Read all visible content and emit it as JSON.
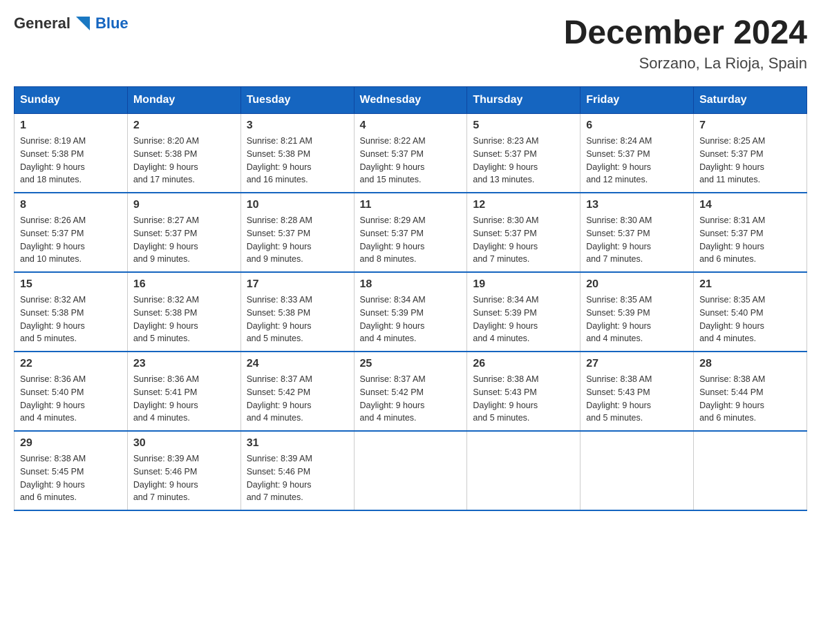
{
  "logo": {
    "general": "General",
    "blue": "Blue"
  },
  "title": "December 2024",
  "location": "Sorzano, La Rioja, Spain",
  "days_of_week": [
    "Sunday",
    "Monday",
    "Tuesday",
    "Wednesday",
    "Thursday",
    "Friday",
    "Saturday"
  ],
  "weeks": [
    [
      {
        "day": "1",
        "sunrise": "8:19 AM",
        "sunset": "5:38 PM",
        "daylight": "9 hours and 18 minutes."
      },
      {
        "day": "2",
        "sunrise": "8:20 AM",
        "sunset": "5:38 PM",
        "daylight": "9 hours and 17 minutes."
      },
      {
        "day": "3",
        "sunrise": "8:21 AM",
        "sunset": "5:38 PM",
        "daylight": "9 hours and 16 minutes."
      },
      {
        "day": "4",
        "sunrise": "8:22 AM",
        "sunset": "5:37 PM",
        "daylight": "9 hours and 15 minutes."
      },
      {
        "day": "5",
        "sunrise": "8:23 AM",
        "sunset": "5:37 PM",
        "daylight": "9 hours and 13 minutes."
      },
      {
        "day": "6",
        "sunrise": "8:24 AM",
        "sunset": "5:37 PM",
        "daylight": "9 hours and 12 minutes."
      },
      {
        "day": "7",
        "sunrise": "8:25 AM",
        "sunset": "5:37 PM",
        "daylight": "9 hours and 11 minutes."
      }
    ],
    [
      {
        "day": "8",
        "sunrise": "8:26 AM",
        "sunset": "5:37 PM",
        "daylight": "9 hours and 10 minutes."
      },
      {
        "day": "9",
        "sunrise": "8:27 AM",
        "sunset": "5:37 PM",
        "daylight": "9 hours and 9 minutes."
      },
      {
        "day": "10",
        "sunrise": "8:28 AM",
        "sunset": "5:37 PM",
        "daylight": "9 hours and 9 minutes."
      },
      {
        "day": "11",
        "sunrise": "8:29 AM",
        "sunset": "5:37 PM",
        "daylight": "9 hours and 8 minutes."
      },
      {
        "day": "12",
        "sunrise": "8:30 AM",
        "sunset": "5:37 PM",
        "daylight": "9 hours and 7 minutes."
      },
      {
        "day": "13",
        "sunrise": "8:30 AM",
        "sunset": "5:37 PM",
        "daylight": "9 hours and 7 minutes."
      },
      {
        "day": "14",
        "sunrise": "8:31 AM",
        "sunset": "5:37 PM",
        "daylight": "9 hours and 6 minutes."
      }
    ],
    [
      {
        "day": "15",
        "sunrise": "8:32 AM",
        "sunset": "5:38 PM",
        "daylight": "9 hours and 5 minutes."
      },
      {
        "day": "16",
        "sunrise": "8:32 AM",
        "sunset": "5:38 PM",
        "daylight": "9 hours and 5 minutes."
      },
      {
        "day": "17",
        "sunrise": "8:33 AM",
        "sunset": "5:38 PM",
        "daylight": "9 hours and 5 minutes."
      },
      {
        "day": "18",
        "sunrise": "8:34 AM",
        "sunset": "5:39 PM",
        "daylight": "9 hours and 4 minutes."
      },
      {
        "day": "19",
        "sunrise": "8:34 AM",
        "sunset": "5:39 PM",
        "daylight": "9 hours and 4 minutes."
      },
      {
        "day": "20",
        "sunrise": "8:35 AM",
        "sunset": "5:39 PM",
        "daylight": "9 hours and 4 minutes."
      },
      {
        "day": "21",
        "sunrise": "8:35 AM",
        "sunset": "5:40 PM",
        "daylight": "9 hours and 4 minutes."
      }
    ],
    [
      {
        "day": "22",
        "sunrise": "8:36 AM",
        "sunset": "5:40 PM",
        "daylight": "9 hours and 4 minutes."
      },
      {
        "day": "23",
        "sunrise": "8:36 AM",
        "sunset": "5:41 PM",
        "daylight": "9 hours and 4 minutes."
      },
      {
        "day": "24",
        "sunrise": "8:37 AM",
        "sunset": "5:42 PM",
        "daylight": "9 hours and 4 minutes."
      },
      {
        "day": "25",
        "sunrise": "8:37 AM",
        "sunset": "5:42 PM",
        "daylight": "9 hours and 4 minutes."
      },
      {
        "day": "26",
        "sunrise": "8:38 AM",
        "sunset": "5:43 PM",
        "daylight": "9 hours and 5 minutes."
      },
      {
        "day": "27",
        "sunrise": "8:38 AM",
        "sunset": "5:43 PM",
        "daylight": "9 hours and 5 minutes."
      },
      {
        "day": "28",
        "sunrise": "8:38 AM",
        "sunset": "5:44 PM",
        "daylight": "9 hours and 6 minutes."
      }
    ],
    [
      {
        "day": "29",
        "sunrise": "8:38 AM",
        "sunset": "5:45 PM",
        "daylight": "9 hours and 6 minutes."
      },
      {
        "day": "30",
        "sunrise": "8:39 AM",
        "sunset": "5:46 PM",
        "daylight": "9 hours and 7 minutes."
      },
      {
        "day": "31",
        "sunrise": "8:39 AM",
        "sunset": "5:46 PM",
        "daylight": "9 hours and 7 minutes."
      },
      null,
      null,
      null,
      null
    ]
  ],
  "labels": {
    "sunrise": "Sunrise:",
    "sunset": "Sunset:",
    "daylight": "Daylight:"
  }
}
